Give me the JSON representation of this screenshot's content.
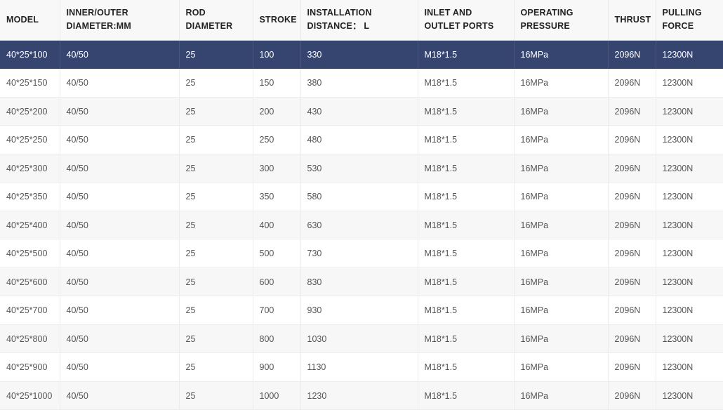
{
  "table": {
    "columns": [
      {
        "key": "model",
        "label": "MODEL",
        "class": "c-model"
      },
      {
        "key": "io",
        "label": "INNER/OUTER DIAMETER:MM",
        "class": "c-io"
      },
      {
        "key": "rod",
        "label": "ROD DIAMETER",
        "class": "c-rod"
      },
      {
        "key": "stroke",
        "label": "STROKE",
        "class": "c-stroke"
      },
      {
        "key": "install",
        "label": "INSTALLATION DISTANCE： L",
        "class": "c-install"
      },
      {
        "key": "ports",
        "label": "INLET AND OUTLET PORTS",
        "class": "c-ports"
      },
      {
        "key": "pressure",
        "label": "OPERATING PRESSURE",
        "class": "c-press"
      },
      {
        "key": "thrust",
        "label": "THRUST",
        "class": "c-thrust"
      },
      {
        "key": "pull",
        "label": "PULLING FORCE",
        "class": "c-pull"
      }
    ],
    "rows": [
      {
        "highlighted": true,
        "cells": [
          "40*25*100",
          "40/50",
          "25",
          "100",
          "330",
          "M18*1.5",
          "16MPa",
          "2096N",
          "12300N"
        ]
      },
      {
        "highlighted": false,
        "cells": [
          "40*25*150",
          "40/50",
          "25",
          "150",
          "380",
          "M18*1.5",
          "16MPa",
          "2096N",
          "12300N"
        ]
      },
      {
        "highlighted": false,
        "cells": [
          "40*25*200",
          "40/50",
          "25",
          "200",
          "430",
          "M18*1.5",
          "16MPa",
          "2096N",
          "12300N"
        ]
      },
      {
        "highlighted": false,
        "cells": [
          "40*25*250",
          "40/50",
          "25",
          "250",
          "480",
          "M18*1.5",
          "16MPa",
          "2096N",
          "12300N"
        ]
      },
      {
        "highlighted": false,
        "cells": [
          "40*25*300",
          "40/50",
          "25",
          "300",
          "530",
          "M18*1.5",
          "16MPa",
          "2096N",
          "12300N"
        ]
      },
      {
        "highlighted": false,
        "cells": [
          "40*25*350",
          "40/50",
          "25",
          "350",
          "580",
          "M18*1.5",
          "16MPa",
          "2096N",
          "12300N"
        ]
      },
      {
        "highlighted": false,
        "cells": [
          "40*25*400",
          "40/50",
          "25",
          "400",
          "630",
          "M18*1.5",
          "16MPa",
          "2096N",
          "12300N"
        ]
      },
      {
        "highlighted": false,
        "cells": [
          "40*25*500",
          "40/50",
          "25",
          "500",
          "730",
          "M18*1.5",
          "16MPa",
          "2096N",
          "12300N"
        ]
      },
      {
        "highlighted": false,
        "cells": [
          "40*25*600",
          "40/50",
          "25",
          "600",
          "830",
          "M18*1.5",
          "16MPa",
          "2096N",
          "12300N"
        ]
      },
      {
        "highlighted": false,
        "cells": [
          "40*25*700",
          "40/50",
          "25",
          "700",
          "930",
          "M18*1.5",
          "16MPa",
          "2096N",
          "12300N"
        ]
      },
      {
        "highlighted": false,
        "cells": [
          "40*25*800",
          "40/50",
          "25",
          "800",
          "1030",
          "M18*1.5",
          "16MPa",
          "2096N",
          "12300N"
        ]
      },
      {
        "highlighted": false,
        "cells": [
          "40*25*900",
          "40/50",
          "25",
          "900",
          "1130",
          "M18*1.5",
          "16MPa",
          "2096N",
          "12300N"
        ]
      },
      {
        "highlighted": false,
        "cells": [
          "40*25*1000",
          "40/50",
          "25",
          "1000",
          "1230",
          "M18*1.5",
          "16MPa",
          "2096N",
          "12300N"
        ]
      }
    ]
  },
  "colors": {
    "highlight_row_background": "#36456f",
    "highlight_row_text": "#ffffff",
    "header_background": "#f8f8f8",
    "header_text": "#222222",
    "body_text": "#555555",
    "stripe_background": "#f7f7f7",
    "border": "#ececec"
  }
}
